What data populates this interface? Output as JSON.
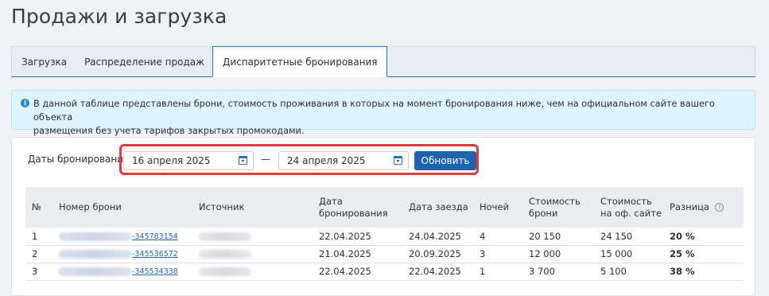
{
  "page": {
    "title": "Продажи и загрузка"
  },
  "tabs": [
    {
      "label": "Загрузка",
      "active": false
    },
    {
      "label": "Распределение продаж",
      "active": false
    },
    {
      "label": "Диспаритетные бронирования",
      "active": true
    }
  ],
  "info": {
    "icon": "info-icon",
    "text_line1": "В данной таблице представлены брони, стоимость проживания в которых на момент бронирования ниже, чем на официальном сайте вашего объекта",
    "text_line2": "размещения без учета тарифов закрытых промокодами."
  },
  "filters": {
    "dates_label": "Даты бронирования",
    "date_from": "16 апреля 2025",
    "date_separator": "—",
    "date_to": "24 апреля 2025",
    "update_label": "Обновить",
    "highlight_color": "#e03a3a"
  },
  "table": {
    "headers": {
      "num": "№",
      "booking": "Номер брони",
      "source": "Источник",
      "booking_date_1": "Дата",
      "booking_date_2": "бронирования",
      "checkin": "Дата заезда",
      "nights": "Ночей",
      "cost_1": "Стоимость",
      "cost_2": "брони",
      "site_cost_1": "Стоимость",
      "site_cost_2": "на оф. сайте",
      "diff": "Разница"
    },
    "rows": [
      {
        "num": "1",
        "booking_suffix": "-345783154",
        "booking_date": "22.04.2025",
        "checkin": "24.04.2025",
        "nights": "4",
        "cost": "20 150",
        "site_cost": "24 150",
        "diff": "20 %"
      },
      {
        "num": "2",
        "booking_suffix": "-345536572",
        "booking_date": "21.04.2025",
        "checkin": "20.09.2025",
        "nights": "3",
        "cost": "12 000",
        "site_cost": "15 000",
        "diff": "25 %"
      },
      {
        "num": "3",
        "booking_suffix": "-345534338",
        "booking_date": "22.04.2025",
        "checkin": "22.04.2025",
        "nights": "1",
        "cost": "3 700",
        "site_cost": "5 100",
        "diff": "38 %"
      }
    ]
  },
  "colors": {
    "accent": "#1f63ad",
    "difference": "#d11f1f",
    "info_bg": "#def3fb"
  }
}
